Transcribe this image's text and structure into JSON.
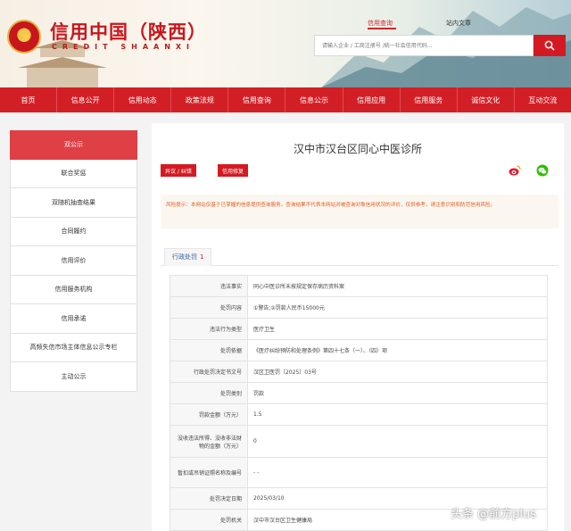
{
  "header": {
    "brand_cn": "信用中国（陕西）",
    "brand_en": "CREDIT  SHAANXI",
    "tabs": [
      "信用查询",
      "站内文章"
    ],
    "search_placeholder": "请输入企业 / 工商注册号 /统一社会信用代码..."
  },
  "nav": {
    "items": [
      "首页",
      "信息公开",
      "信用动态",
      "政策法规",
      "信用查询",
      "信息公示",
      "信用应用",
      "信用服务",
      "诚信文化",
      "互动交流"
    ]
  },
  "sidebar": {
    "items": [
      "双公示",
      "联合奖惩",
      "双随机抽查结果",
      "合同履约",
      "信用评价",
      "信用服务机构",
      "信用承诺",
      "高频失信市场主体信息公示专栏",
      "主动公示"
    ]
  },
  "main": {
    "title": "汉中市汉台区同心中医诊所",
    "objection_label": "异议 / 纠错",
    "repair_label": "信用修复",
    "notice": "风险提示：本网站仅基于已掌握的信息提供查询服务，查询结果不代表本网站对被查询对象信用状况的评价，仅供参考，请注意识别和防范信用风险。",
    "tab_label": "行政处罚",
    "tab_count": "1",
    "rows": [
      {
        "label": "违法事实",
        "value": "同心中医诊所未按规定保存病历资料案"
      },
      {
        "label": "处罚内容",
        "value": "①警告;②罚款人民币15000元"
      },
      {
        "label": "违法行为类型",
        "value": "医疗卫生"
      },
      {
        "label": "处罚依据",
        "value": "《医疗纠纷预防和处理条例》第四十七条（一）、（四）项"
      },
      {
        "label": "行政处罚决定书文号",
        "value": "汉区卫医罚〔2025〕03号"
      },
      {
        "label": "处罚类别",
        "value": "罚款"
      },
      {
        "label": "罚款金额（万元）",
        "value": "1.5"
      },
      {
        "label": "没收违法所得、没收非法财物的金额（万元）",
        "value": "0"
      },
      {
        "label": "暂扣或吊销证照名称及编号",
        "value": "- -"
      },
      {
        "label": "处罚决定日期",
        "value": "2025/03/10"
      },
      {
        "label": "处罚机关",
        "value": "汉中市汉台区卫生健康局"
      }
    ]
  },
  "watermark": "头条 @前方plus",
  "colors": {
    "brand_red": "#d21f26",
    "sidebar_active": "#de4046",
    "notice_text": "#e45a20"
  }
}
